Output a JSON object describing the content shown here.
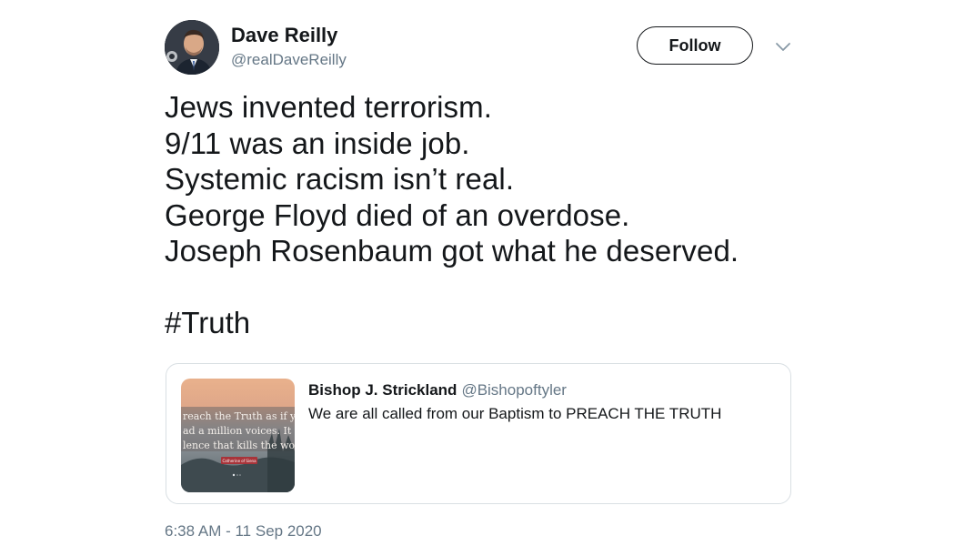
{
  "author": {
    "name": "Dave Reilly",
    "handle": "@realDaveReilly",
    "avatar_icon": "profile-photo"
  },
  "actions": {
    "follow_label": "Follow",
    "more_icon": "chevron-down-icon"
  },
  "tweet": {
    "lines": [
      "Jews invented terrorism.",
      "9/11 was an inside job.",
      "Systemic racism isn’t real.",
      "George Floyd died of an overdose.",
      "Joseph Rosenbaum got what he deserved."
    ],
    "hashtag": "#Truth",
    "timestamp": "6:38 AM - 11 Sep 2020"
  },
  "quoted_tweet": {
    "name": "Bishop J. Strickland",
    "handle": "@Bishopoftyler",
    "text": "We are all called from our Baptism to PREACH THE TRUTH",
    "media": {
      "caption_lines": [
        "reach the Truth as if yo",
        "ad a million voices. It",
        "lence that kills the worl"
      ],
      "attribution": "Catherine of Siena"
    }
  },
  "colors": {
    "text_primary": "#14171a",
    "text_secondary": "#657786",
    "border": "#d9dfe3",
    "background": "#ffffff"
  }
}
